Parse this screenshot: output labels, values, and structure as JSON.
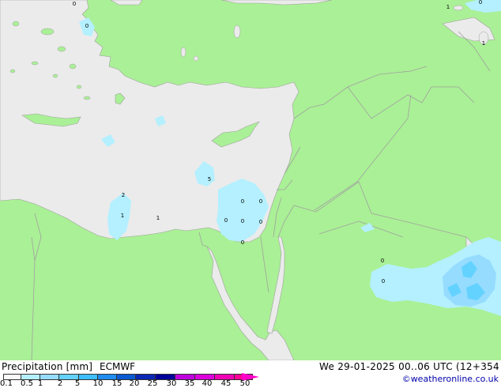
{
  "legend": {
    "title": "Precipitation [mm]",
    "model": "ECMWF",
    "ticks": [
      "0.1",
      "0.5",
      "1",
      "2",
      "5",
      "10",
      "15",
      "20",
      "25",
      "30",
      "35",
      "40",
      "45",
      "50"
    ],
    "colors": [
      "#fafafa",
      "#b4f0ff",
      "#96dcff",
      "#64d2ff",
      "#3cbeff",
      "#1e8cf0",
      "#0a5ad2",
      "#0a28b4",
      "#00009a",
      "#be00dc",
      "#dc00dc",
      "#f000b4",
      "#ff0096",
      "#ff00c8"
    ]
  },
  "validity": "We 29-01-2025 00..06 UTC (12+354",
  "credit": "©weatheronline.co.uk",
  "map": {
    "land_color": "#aaf096",
    "sea_color": "#ebebeb",
    "border_color": "#a0a0a0",
    "precip_light": "#b4f0ff",
    "precip_medium": "#96dcff",
    "precip_heavy": "#64d2ff",
    "marker_labels": [
      "0",
      "1",
      "0",
      "0",
      "1",
      "2",
      "1",
      "1",
      "5",
      "0",
      "0",
      "0",
      "0",
      "0",
      "0",
      "0",
      "0"
    ]
  }
}
